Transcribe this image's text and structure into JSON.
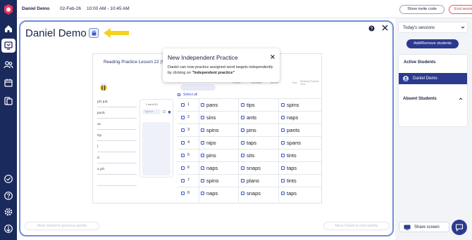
{
  "topbar": {
    "student_name": "Daniel Demo",
    "date": "02-Feb-26",
    "time": "10:00 AM - 10:45 AM",
    "invite_label": "Show invite code",
    "end_label": "End session"
  },
  "main": {
    "title": "Daniel Demo",
    "prev_label": "Move Daniel to previous activity",
    "next_label": "Move Daniel to next activity"
  },
  "activity": {
    "lesson_title": "Reading Practice Lesson 22 (581)",
    "page_indicator": "1 out of 10",
    "type_placeholder": "Type he",
    "column_headers": [
      "Correct",
      "Accuracy",
      "WCPM",
      "Time",
      "Reading Practice View"
    ],
    "select_all": "Select all",
    "notebook_rows": [
      "pit pat",
      "pack",
      "as",
      "tip",
      "l",
      "it",
      "a pit",
      "",
      ""
    ],
    "rows": [
      {
        "n": "1",
        "words": [
          "pans",
          "tips",
          "spins"
        ]
      },
      {
        "n": "2",
        "words": [
          "sins",
          "ants",
          "naps"
        ]
      },
      {
        "n": "3",
        "words": [
          "spins",
          "pins",
          "pants"
        ]
      },
      {
        "n": "4",
        "words": [
          "nips",
          "taps",
          "spans"
        ]
      },
      {
        "n": "5",
        "words": [
          "pins",
          "sits",
          "tints"
        ]
      },
      {
        "n": "6",
        "words": [
          "naps",
          "snaps",
          "taps"
        ]
      },
      {
        "n": "7",
        "words": [
          "spins",
          "plans",
          "tints"
        ]
      },
      {
        "n": "8",
        "words": [
          "naps",
          "snaps",
          "taps"
        ]
      }
    ]
  },
  "popup": {
    "title": "New Independent Practice",
    "body_start": "Daniel can now practice assigned word targets independently by clicking on ",
    "body_bold": "\"Independent practice\""
  },
  "right": {
    "sessions_label": "Today's sessions",
    "add_label": "Add/Remove students",
    "active_label": "Active Students",
    "active_student": "Daniel Demo",
    "absent_label": "Absent Students",
    "share_label": "Share screen"
  },
  "colors": {
    "nav": "#1b2a5c",
    "accent": "#2b3a8f",
    "border": "#6f8ed9",
    "end": "#d23c3c",
    "arrow": "#f4d21d"
  }
}
